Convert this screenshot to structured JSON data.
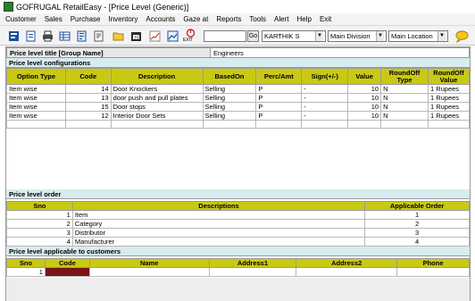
{
  "window": {
    "title": "GOFRUGAL RetailEasy - [Price Level (Generic)]"
  },
  "menu": [
    "Customer",
    "Sales",
    "Purchase",
    "Inventory",
    "Accounts",
    "Gaze at",
    "Reports",
    "Tools",
    "Alert",
    "Help",
    "Exit"
  ],
  "toolbar": {
    "exit_label": "EXIT",
    "go_label": "Go",
    "user": "KARTHIK S",
    "division": "Main Division",
    "location": "Main Location",
    "search_value": ""
  },
  "form": {
    "title_label": "Price level title [Group Name]",
    "title_value": "Engineers"
  },
  "config": {
    "section_label": "Price level configurations",
    "headers": [
      "Option Type",
      "Code",
      "Description",
      "BasedOn",
      "Perc/Amt",
      "Sign(+/-)",
      "Value",
      "RoundOff Type",
      "RoundOff Value"
    ],
    "rows": [
      [
        "Item wise",
        "14",
        "Door Knockers",
        "Selling",
        "P",
        "-",
        "10",
        "N",
        "1 Rupees"
      ],
      [
        "Item wise",
        "13",
        "door push and pull plates",
        "Selling",
        "P",
        "-",
        "10",
        "N",
        "1 Rupees"
      ],
      [
        "Item wise",
        "15",
        "Door stops",
        "Selling",
        "P",
        "-",
        "10",
        "N",
        "1 Rupees"
      ],
      [
        "Item wise",
        "12",
        "Interior Door Sets",
        "Selling",
        "P",
        "-",
        "10",
        "N",
        "1 Rupees"
      ]
    ]
  },
  "order": {
    "section_label": "Price level order",
    "headers": [
      "Sno",
      "Descriptions",
      "Applicable Order"
    ],
    "rows": [
      [
        "1",
        "Item",
        "1"
      ],
      [
        "2",
        "Category",
        "2"
      ],
      [
        "3",
        "Distributor",
        "3"
      ],
      [
        "4",
        "Manufacturer",
        "4"
      ]
    ]
  },
  "customers": {
    "section_label": "Price level applicable to customers",
    "headers": [
      "Sno",
      "Code",
      "Name",
      "Address1",
      "Address2",
      "Phone"
    ],
    "rows": [
      [
        "1",
        "",
        "",
        "",
        "",
        ""
      ]
    ]
  },
  "colors": {
    "header_bg": "#c9c914",
    "section_bg": "#d8ecef",
    "code_cell": "#7a1414"
  }
}
